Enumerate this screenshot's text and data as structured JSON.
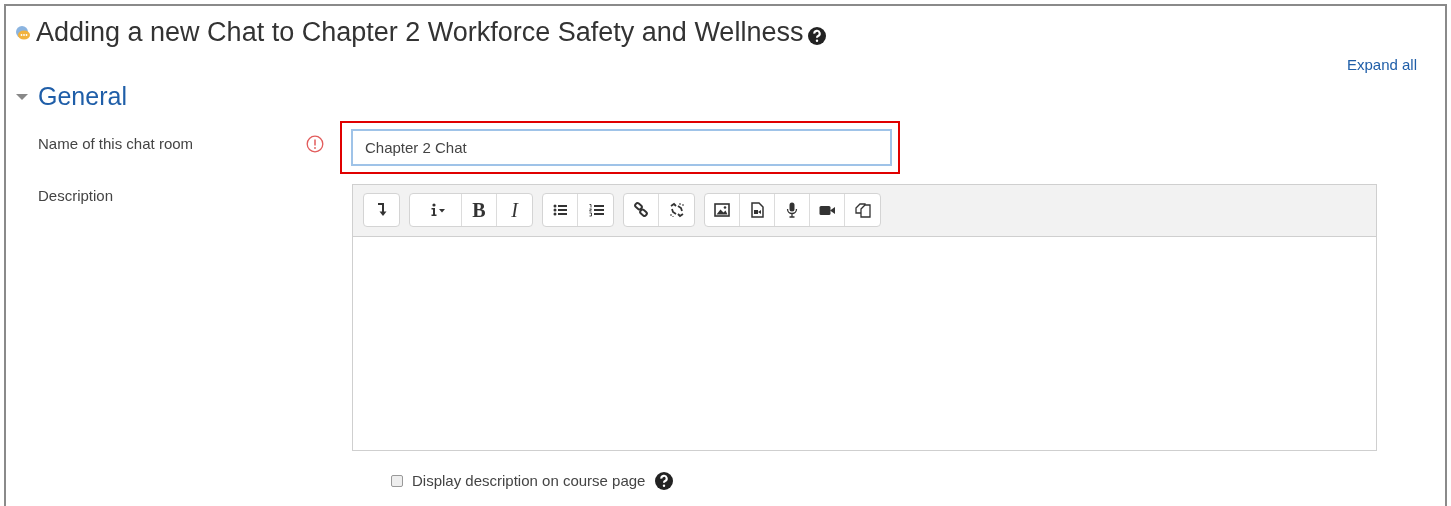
{
  "page_title": "Adding a new Chat to Chapter 2 Workforce Safety and Wellness",
  "expand_link": "Expand all",
  "section": {
    "title": "General",
    "expanded": true
  },
  "name_field": {
    "label": "Name of this chat room",
    "required": true,
    "value": "Chapter 2 Chat",
    "highlighted": true
  },
  "description": {
    "label": "Description",
    "toolbar_groups": [
      {
        "buttons": [
          {
            "kind": "icon"
          }
        ]
      },
      {
        "buttons": [
          {
            "kind": "icon"
          },
          {
            "kind": "bold",
            "label": "B"
          },
          {
            "kind": "italic",
            "label": "I"
          }
        ]
      },
      {
        "buttons": [
          {
            "kind": "icon"
          },
          {
            "kind": "icon"
          }
        ]
      },
      {
        "buttons": [
          {
            "kind": "icon"
          },
          {
            "kind": "icon"
          }
        ]
      },
      {
        "buttons": [
          {
            "kind": "icon"
          },
          {
            "kind": "icon"
          },
          {
            "kind": "icon"
          },
          {
            "kind": "icon"
          },
          {
            "kind": "icon"
          }
        ]
      }
    ]
  },
  "display_description": {
    "label": "Display description on course page",
    "checked": false
  }
}
